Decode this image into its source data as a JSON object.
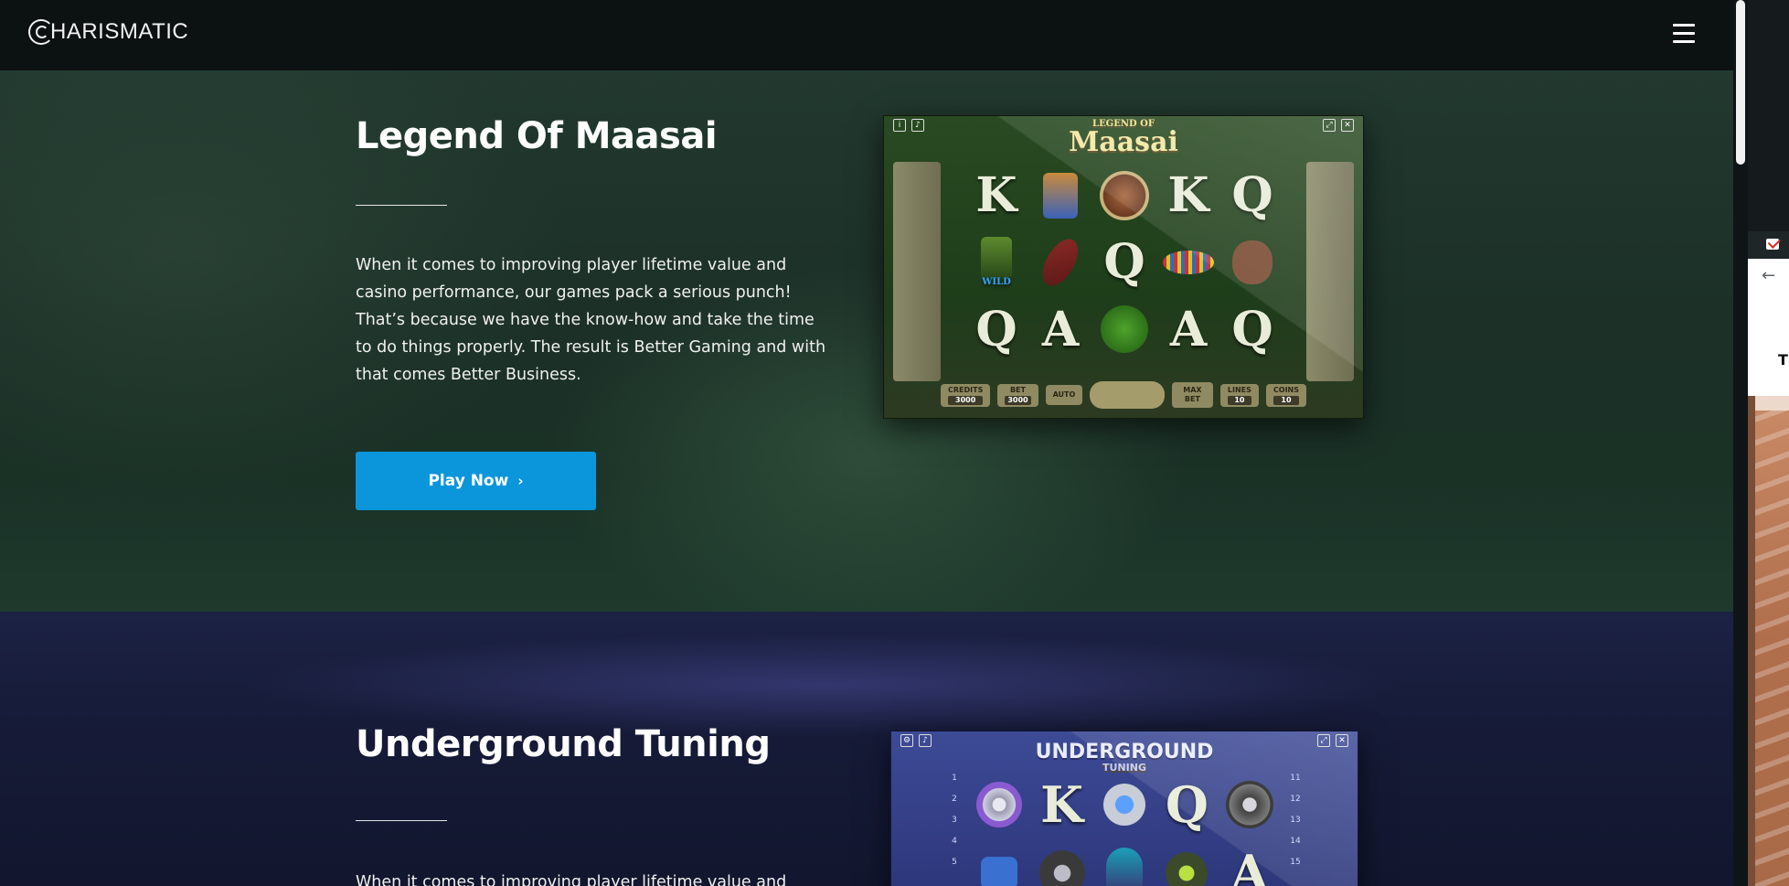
{
  "brand": {
    "name": "HARISMATIC",
    "logo_letter": "C"
  },
  "header": {
    "menu_icon": "hamburger-icon"
  },
  "games": [
    {
      "title": "Legend Of Maasai",
      "description": "When it comes to improving player lifetime value and casino performance, our games pack a serious punch! That’s because we have the know-how and take the time to do things properly. The result is Better Gaming and with that comes Better Business.",
      "cta_label": "Play Now",
      "screenshot": {
        "logo_top": "LEGEND OF",
        "logo_main": "Maasai",
        "reels": [
          "K",
          "",
          "",
          "K",
          "Q",
          "",
          "",
          "Q",
          "",
          "",
          "Q",
          "A",
          "",
          "A",
          "Q"
        ],
        "wild_label": "WILD",
        "credits_label": "CREDITS",
        "credits_value": "3000",
        "bet_label": "BET",
        "bet_value": "3000",
        "auto_label": "AUTO",
        "maxbet_label": "MAX BET",
        "lines_label": "LINES",
        "lines_value": "10",
        "coins_label": "COINS",
        "coins_value": "10"
      }
    },
    {
      "title": "Underground Tuning",
      "description": "When it comes to improving player lifetime value and casino",
      "screenshot": {
        "logo_main": "UNDERGROUND",
        "logo_sub": "TUNING",
        "reels": [
          "",
          "K",
          "",
          "Q",
          ""
        ],
        "reels2": [
          "",
          "",
          "",
          "",
          "A"
        ],
        "left_numbers": [
          "1",
          "2",
          "3",
          "4",
          "5"
        ],
        "right_numbers": [
          "11",
          "12",
          "13",
          "14",
          "15"
        ]
      }
    }
  ],
  "side_window": {
    "partial_text": "T"
  }
}
